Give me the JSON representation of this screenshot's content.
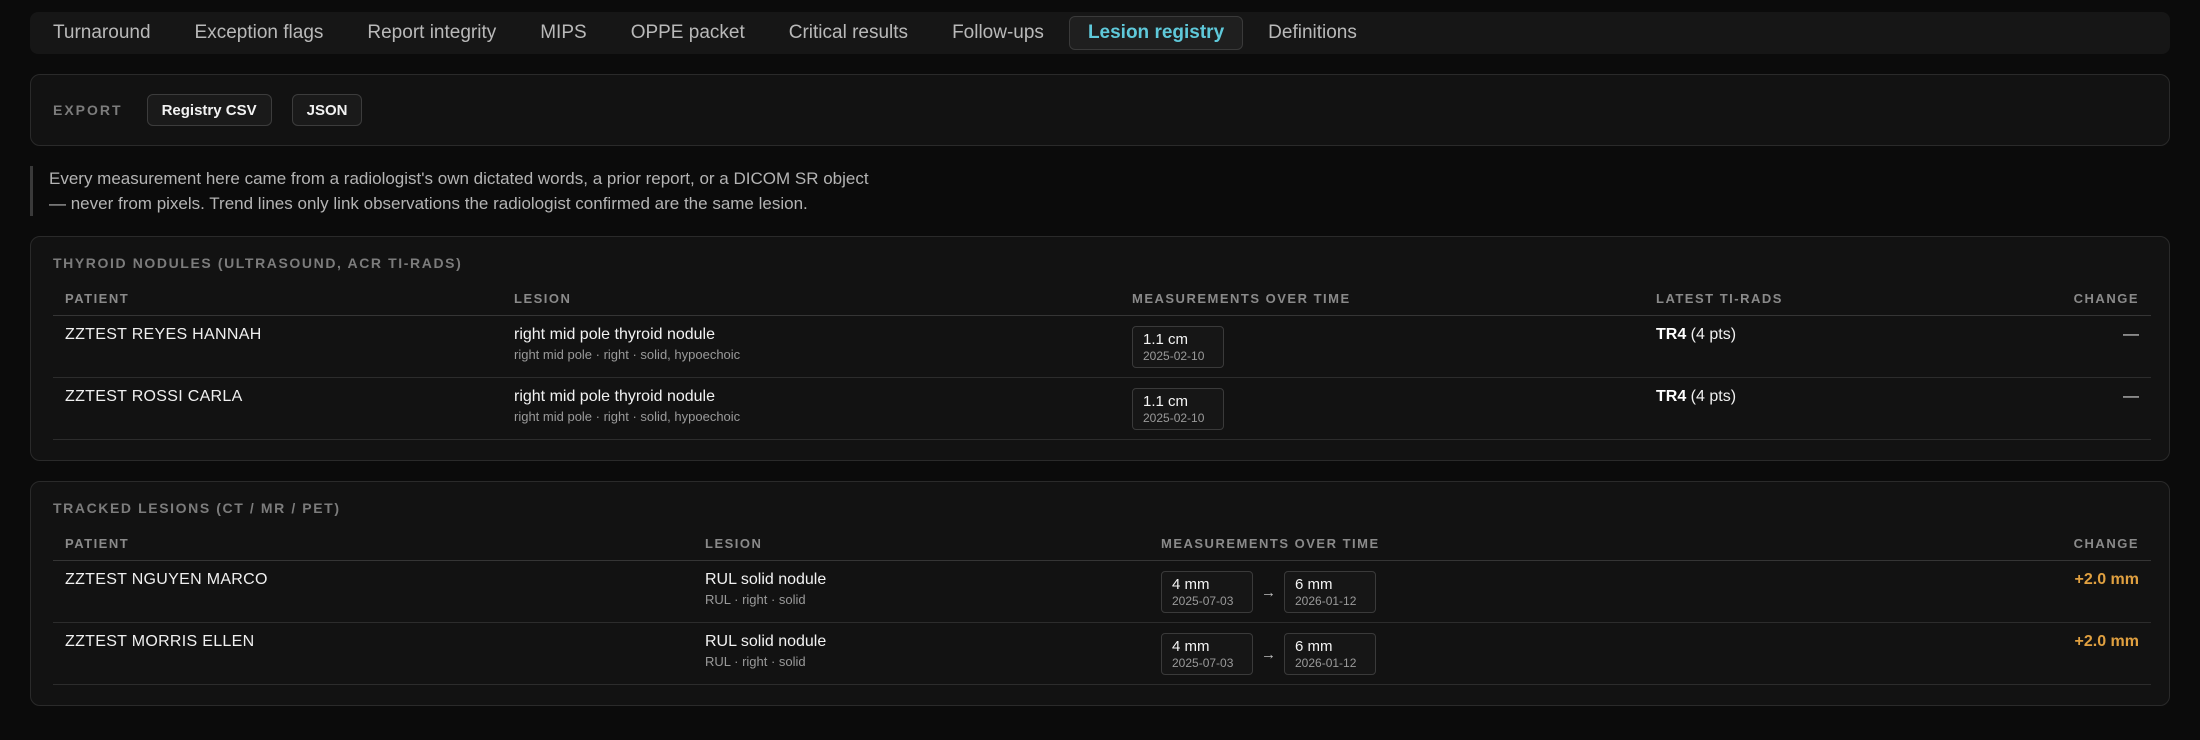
{
  "tabs": [
    {
      "label": "Turnaround",
      "active": false
    },
    {
      "label": "Exception flags",
      "active": false
    },
    {
      "label": "Report integrity",
      "active": false
    },
    {
      "label": "MIPS",
      "active": false
    },
    {
      "label": "OPPE packet",
      "active": false
    },
    {
      "label": "Critical results",
      "active": false
    },
    {
      "label": "Follow-ups",
      "active": false
    },
    {
      "label": "Lesion registry",
      "active": true
    },
    {
      "label": "Definitions",
      "active": false
    }
  ],
  "export": {
    "label": "EXPORT",
    "csv_label": "Registry CSV",
    "json_label": "JSON"
  },
  "note": "Every measurement here came from a radiologist's own dictated words, a prior report, or a DICOM SR object — never from pixels. Trend lines only link observations the radiologist confirmed are the same lesion.",
  "thyroid": {
    "title": "THYROID NODULES (ULTRASOUND, ACR TI-RADS)",
    "headers": {
      "patient": "PATIENT",
      "lesion": "LESION",
      "measurements": "MEASUREMENTS OVER TIME",
      "tirads": "LATEST TI-RADS",
      "change": "CHANGE"
    },
    "rows": [
      {
        "patient": "ZZTEST REYES HANNAH",
        "lesion": "right mid pole thyroid nodule",
        "lesion_detail": "right mid pole · right · solid, hypoechoic",
        "measurements": [
          {
            "value": "1.1 cm",
            "date": "2025-02-10"
          }
        ],
        "tirads_grade": "TR4",
        "tirads_pts": " (4 pts)",
        "change": "—"
      },
      {
        "patient": "ZZTEST ROSSI CARLA",
        "lesion": "right mid pole thyroid nodule",
        "lesion_detail": "right mid pole · right · solid, hypoechoic",
        "measurements": [
          {
            "value": "1.1 cm",
            "date": "2025-02-10"
          }
        ],
        "tirads_grade": "TR4",
        "tirads_pts": " (4 pts)",
        "change": "—"
      }
    ]
  },
  "tracked": {
    "title": "TRACKED LESIONS (CT / MR / PET)",
    "headers": {
      "patient": "PATIENT",
      "lesion": "LESION",
      "measurements": "MEASUREMENTS OVER TIME",
      "change": "CHANGE"
    },
    "rows": [
      {
        "patient": "ZZTEST NGUYEN MARCO",
        "lesion": "RUL solid nodule",
        "lesion_detail": "RUL · right · solid",
        "measurements": [
          {
            "value": "4 mm",
            "date": "2025-07-03"
          },
          {
            "value": "6 mm",
            "date": "2026-01-12"
          }
        ],
        "change": "+2.0 mm"
      },
      {
        "patient": "ZZTEST MORRIS ELLEN",
        "lesion": "RUL solid nodule",
        "lesion_detail": "RUL · right · solid",
        "measurements": [
          {
            "value": "4 mm",
            "date": "2025-07-03"
          },
          {
            "value": "6 mm",
            "date": "2026-01-12"
          }
        ],
        "change": "+2.0 mm"
      }
    ]
  },
  "icons": {
    "arrow": "arrow-right-icon",
    "arrow_glyph": "→"
  },
  "colors": {
    "active_tab": "#5fc9da",
    "change_increase": "#e0a040"
  }
}
